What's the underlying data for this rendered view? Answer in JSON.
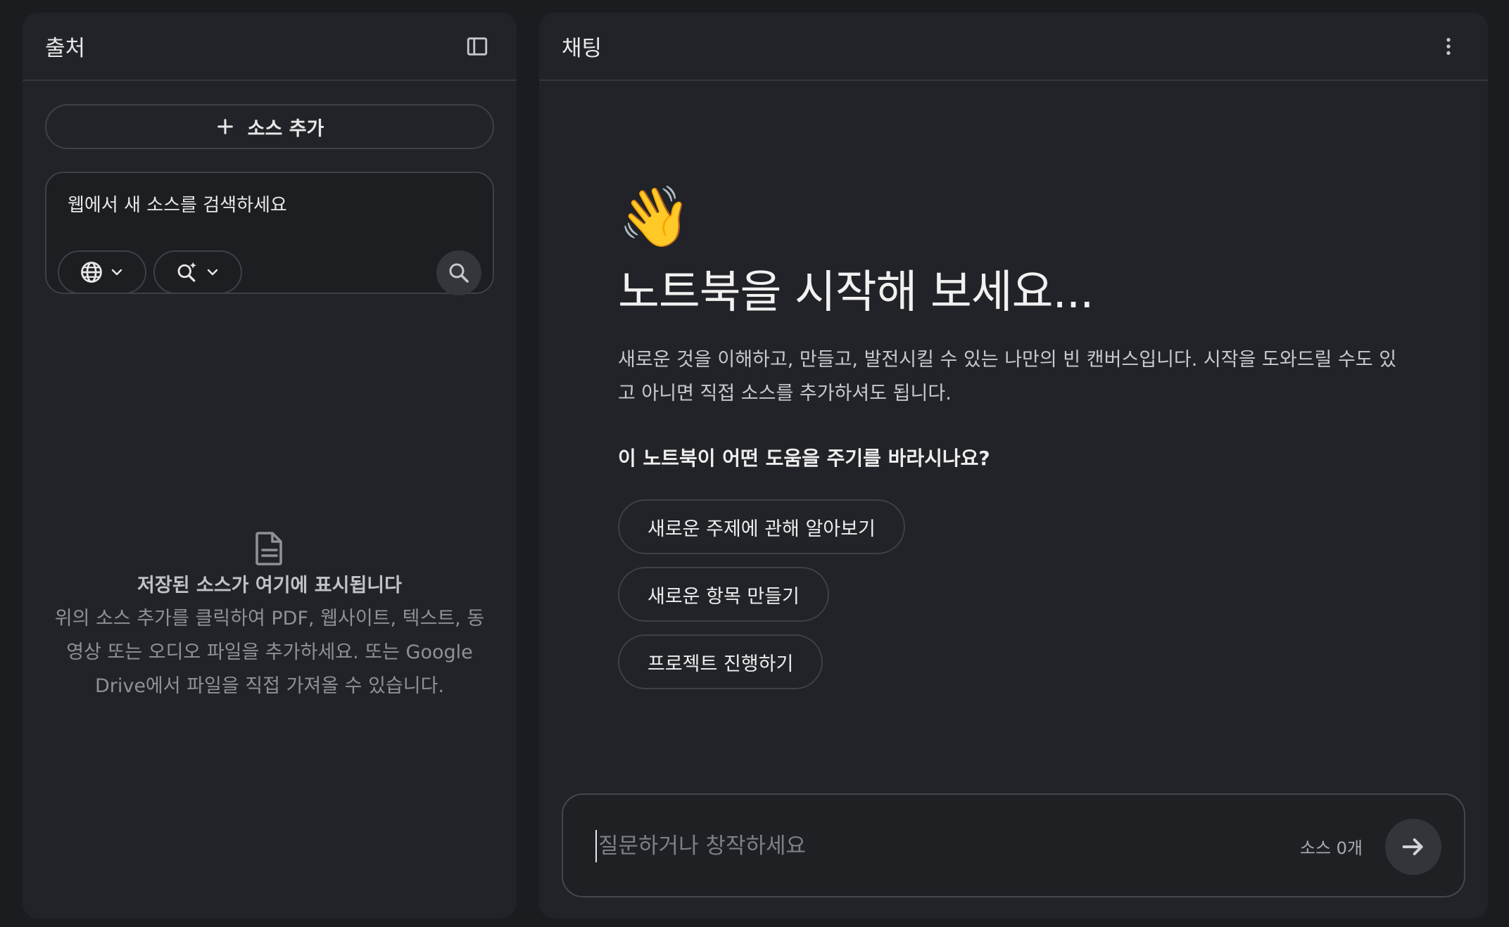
{
  "sources_panel": {
    "title": "출처",
    "toggle_icon": "sidebar-panel-icon",
    "add_source_label": "소스 추가",
    "web_search": {
      "placeholder": "웹에서 새 소스를 검색하세요",
      "web_chip_icon": "globe-icon",
      "research_chip_icon": "sparkle-search-icon",
      "submit_icon": "search-icon"
    },
    "empty_state": {
      "icon": "document-icon",
      "title": "저장된 소스가 여기에 표시됩니다",
      "desc_line1": "위의 소스 추가를 클릭하여 PDF, 웹사이트, 텍스트, 동",
      "desc_line2": "영상 또는 오디오 파일을 추가하세요. 또는 Google",
      "desc_line3": "Drive에서 파일을 직접 가져올 수 있습니다."
    }
  },
  "chat_panel": {
    "title": "채팅",
    "menu_icon": "more-vertical-icon",
    "wave_emoji": "👋",
    "heading": "노트북을 시작해 보세요...",
    "intro_line1": "새로운 것을 이해하고, 만들고, 발전시킬 수 있는 나만의 빈 캔버스입니다. 시작을 도와드릴 수도 있",
    "intro_line2": "고 아니면 직접 소스를 추가하셔도 됩니다.",
    "question": "이 노트북이 어떤 도움을 주기를 바라시나요?",
    "suggestions": [
      "새로운 주제에 관해 알아보기",
      "새로운 항목 만들기",
      "프로젝트 진행하기"
    ],
    "composer": {
      "placeholder": "질문하거나 창작하세요",
      "source_count": "소스 0개",
      "send_icon": "arrow-right-icon"
    }
  },
  "colors": {
    "background": "#1b1c1f",
    "panel": "#212328",
    "border": "#3d4046",
    "text": "#e3e3e3",
    "muted": "#8e9196"
  }
}
